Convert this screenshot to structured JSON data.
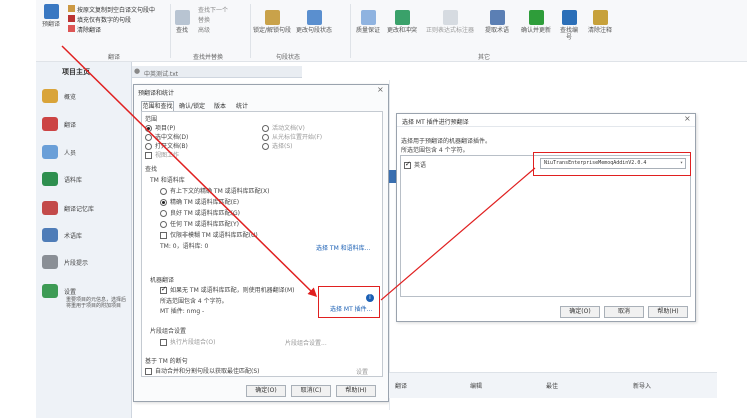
{
  "ribbon": {
    "left_btn": "预翻译",
    "small_items": [
      "按原文复制到空白译文句段中",
      "填充仅有数字的句段",
      "清除翻译"
    ],
    "group_fanyi": "翻译",
    "search_items": [
      "查找下一个",
      "替换",
      "高级"
    ],
    "search_btn": "查找",
    "group_find": "查找并替换",
    "seg_btns": [
      "锁定/解锁句段",
      "更改句段状态"
    ],
    "group_seg": "句段状态",
    "other_btns": [
      "质量保证",
      "更改和冲突",
      "正则表达式标注器",
      "提取术语",
      "确认并更新",
      "查找编号",
      "清除注释"
    ],
    "group_other": "其它"
  },
  "sidebar": {
    "title": "项目主页",
    "items": [
      "概览",
      "翻译",
      "人员",
      "语料库",
      "翻译记忆库",
      "术语库",
      "片段提示",
      "设置"
    ],
    "desc": "重要项目的元信息，选择后将重用于项目的附加项目"
  },
  "tab_title": "中英测试.txt",
  "main_dialog": {
    "title": "预翻译和统计",
    "tabs": [
      "范围和查找",
      "确认/锁定",
      "版本",
      "统计"
    ],
    "scope_label": "范围",
    "scope_opts": [
      "项目(P)",
      "选中文档(D)",
      "打开文档(B)"
    ],
    "scope_right": [
      "活动文档(V)",
      "从光标位置开始(F)",
      "选择(S)"
    ],
    "view_work": "视图工作",
    "find_label": "查找",
    "tm_label": "TM 和语料库",
    "tm_opts": [
      "有上下文的精确 TM 或语料库匹配(X)",
      "精确 TM 或语料库匹配(E)",
      "良好 TM 或语料库匹配(G)",
      "任何 TM 或语料库匹配(Y)",
      "仅限非模糊 TM 或语料库匹配(U)"
    ],
    "tm_count": "TM: 0，语料库: 0",
    "tm_link": "选择 TM 和语料库...",
    "mt_label": "机器翻译",
    "mt_check": "如果无 TM 或语料库匹配，则使用机器翻译(M)",
    "mt_scope": "所选范围包含 4 个字符。",
    "mt_plugin": "MT 插件: nmg -",
    "mt_link": "选择 MT 插件...",
    "frag_label": "片段组合设置",
    "frag_check": "执行片段组合(O)",
    "frag_link": "片段组合设置...",
    "seg_label": "基于 TM 的断句",
    "seg_check": "自动合并和分割句段以获取最佳匹配(S)",
    "seg_set": "设置",
    "ok": "确定(O)",
    "cancel": "取消(C)",
    "help": "帮助(H)"
  },
  "mt_dialog": {
    "title": "选择 MT 插件进行预翻译",
    "desc1": "选择用于预翻译的机器翻译插件。",
    "desc2": "所选范围包含 4 个字符。",
    "lang": "英语",
    "plugin": "NiuTransEnterpriseMemoqAddinV2.0.4",
    "ok": "确定(O)",
    "cancel": "取消",
    "help": "帮助(H)"
  },
  "bottom_cols": [
    "翻译",
    "编辑",
    "最佳",
    "新导入"
  ]
}
